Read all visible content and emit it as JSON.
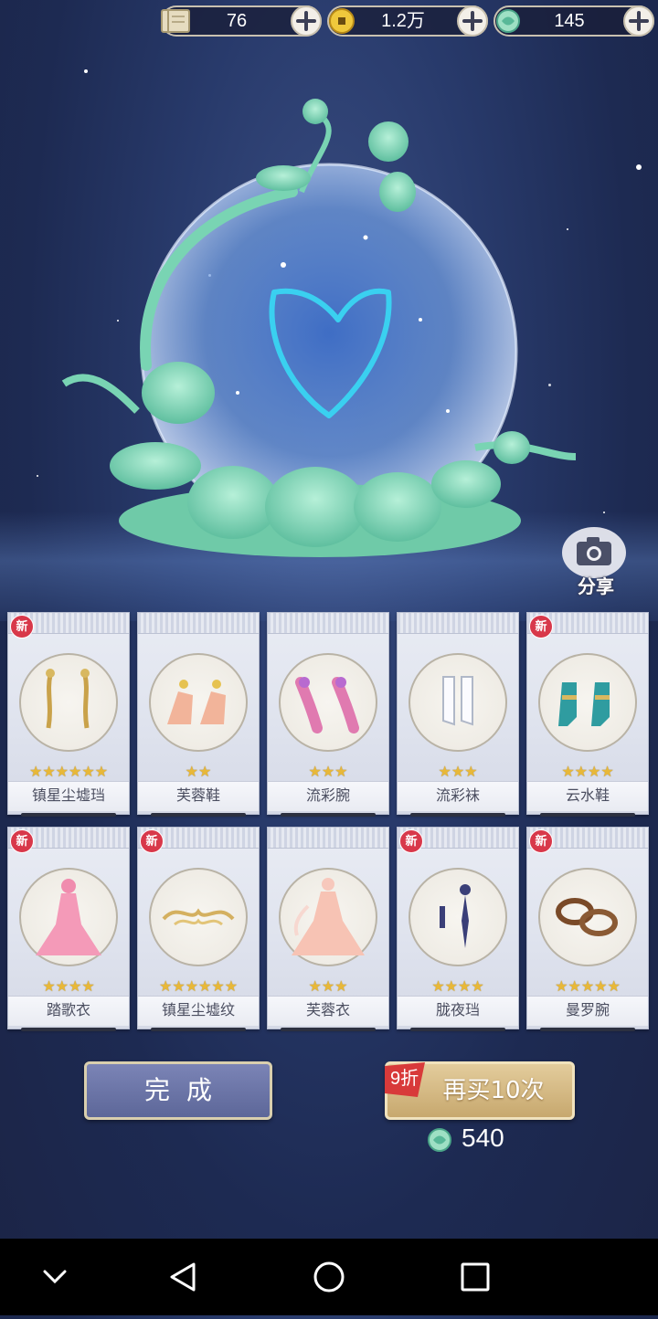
{
  "currency": [
    {
      "icon": "ticket-scroll-icon",
      "value": "76"
    },
    {
      "icon": "gold-coin-icon",
      "value": "1.2万"
    },
    {
      "icon": "jade-stone-icon",
      "value": "145"
    }
  ],
  "share": {
    "label": "分享",
    "icon": "camera-icon"
  },
  "new_badge": "新",
  "cards": [
    {
      "name": "镇星尘墟珰",
      "stars": "★★★★★★",
      "rarity": 6,
      "is_new": true,
      "icon": "gold-earrings-icon"
    },
    {
      "name": "芙蓉鞋",
      "stars": "★★",
      "rarity": 2,
      "is_new": false,
      "icon": "peach-shoes-icon"
    },
    {
      "name": "流彩腕",
      "stars": "★★★",
      "rarity": 3,
      "is_new": false,
      "icon": "pink-bracelet-icon"
    },
    {
      "name": "流彩袜",
      "stars": "★★★",
      "rarity": 3,
      "is_new": false,
      "icon": "white-socks-icon"
    },
    {
      "name": "云水鞋",
      "stars": "★★★★",
      "rarity": 4,
      "is_new": true,
      "icon": "teal-boots-icon"
    },
    {
      "name": "踏歌衣",
      "stars": "★★★★",
      "rarity": 4,
      "is_new": true,
      "icon": "pink-dress-icon"
    },
    {
      "name": "镇星尘墟纹",
      "stars": "★★★★★★",
      "rarity": 6,
      "is_new": true,
      "icon": "gold-ornament-icon"
    },
    {
      "name": "芙蓉衣",
      "stars": "★★★",
      "rarity": 3,
      "is_new": false,
      "icon": "peach-gown-icon"
    },
    {
      "name": "胧夜珰",
      "stars": "★★★★",
      "rarity": 4,
      "is_new": true,
      "icon": "navy-earrings-icon"
    },
    {
      "name": "曼罗腕",
      "stars": "★★★★★",
      "rarity": 5,
      "is_new": true,
      "icon": "bronze-bangles-icon"
    }
  ],
  "buttons": {
    "done": "完成",
    "buy_again": "再买10次",
    "discount": "9折",
    "price": "540",
    "price_icon": "jade-stone-icon"
  },
  "navbar": [
    "chevron-down-icon",
    "back-triangle-icon",
    "home-circle-icon",
    "recents-square-icon"
  ],
  "colors": {
    "star": "#e8b838",
    "new_badge": "#d8384a",
    "jade": "#7fd6b8",
    "done_button": "#6c76a8",
    "buy_button": "#d6bb84"
  }
}
